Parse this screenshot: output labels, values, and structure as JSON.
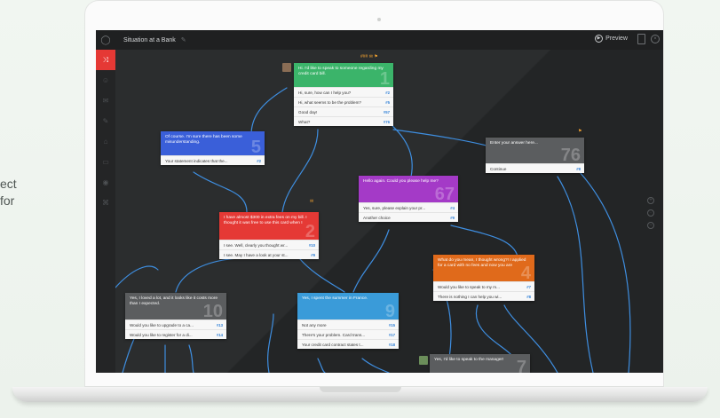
{
  "side_text": {
    "line1": "ect",
    "line2": " for"
  },
  "header": {
    "title": "Situation at a Bank",
    "preview_label": "Preview"
  },
  "sidebar": {
    "icons": [
      "shuffle-icon",
      "person-icon",
      "mail-icon",
      "pencil-icon",
      "tag-icon",
      "chat-icon",
      "pin-icon",
      "share-icon"
    ]
  },
  "nodes": {
    "n1": {
      "text": "Hi. I'd like to speak to someone regarding my credit card bill.",
      "number": "1",
      "color": "#3bb46a",
      "choices": [
        {
          "label": "Hi, sure, how can I help you?",
          "link": "#2"
        },
        {
          "label": "Hi, what seems to be the problem?",
          "link": "#5"
        },
        {
          "label": "Good day!",
          "link": "#57"
        },
        {
          "label": "What?",
          "link": "#76"
        }
      ]
    },
    "n5": {
      "text": "Of course. I'm sure there has been some misunderstanding.",
      "number": "5",
      "color": "#3a5fd9",
      "choices": [
        {
          "label": "Your statement indicates that the...",
          "link": "#2"
        }
      ]
    },
    "n76": {
      "text": "Enter your answer here...",
      "number": "76",
      "color": "#5b5d5f",
      "choices": [
        {
          "label": "Continue",
          "link": "#8"
        }
      ]
    },
    "n67": {
      "text": "Hello again. Could you please help me?",
      "number": "67",
      "color": "#a43ac7",
      "choices": [
        {
          "label": "Yes, sure, please explain your pr...",
          "link": "#4"
        },
        {
          "label": "Another choice",
          "link": "#9"
        }
      ]
    },
    "n2": {
      "text": "I have almost $300 in extra fees on my bill. I thought it was free to use this card when I",
      "number": "2",
      "color": "#e53935",
      "choices": [
        {
          "label": "I see. Well, clearly you thought wr...",
          "link": "#10"
        },
        {
          "label": "I see. May I have a look at your st...",
          "link": "#9"
        }
      ]
    },
    "n4": {
      "text": "What do you mean, I thought wrong?! I applied for a card with no fees and now you are",
      "number": "4",
      "color": "#e06a1b",
      "choices": [
        {
          "label": "Would you like to speak to my m...",
          "link": "#7"
        },
        {
          "label": "There is nothing I can help you wi...",
          "link": "#8"
        }
      ]
    },
    "n10": {
      "text": "Yes, I loved a lot, and it looks like it costs more than I expected.",
      "number": "10",
      "color": "#5b5d5f",
      "choices": [
        {
          "label": "Would you like to upgrade to a ca...",
          "link": "#13"
        },
        {
          "label": "Would you like to register for a di...",
          "link": "#14"
        }
      ]
    },
    "n9": {
      "text": "Yes, I spent the summer in France.",
      "number": "9",
      "color": "#3a9bd9",
      "choices": [
        {
          "label": "Not any more",
          "link": "#15"
        },
        {
          "label": "There's your problem. Card trans...",
          "link": "#17"
        },
        {
          "label": "Your credit card contract states t...",
          "link": "#18"
        }
      ]
    },
    "n7": {
      "text": "Yes, I'd like to speak to the manager!",
      "number": "7",
      "color": "#5b5d5f",
      "choices": []
    }
  },
  "badges": {
    "n1": "### ✉ ⚑",
    "n2": "✉"
  },
  "colors": {
    "accent": "#e53935",
    "edge": "#3e8ee0",
    "canvas": "#2b2d2e"
  }
}
